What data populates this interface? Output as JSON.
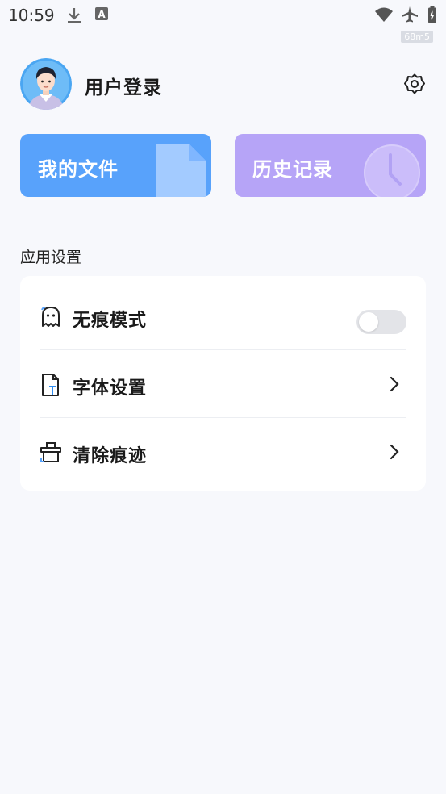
{
  "status_bar": {
    "time": "10:59",
    "fps": "68m5"
  },
  "header": {
    "login_label": "用户登录"
  },
  "cards": {
    "files_label": "我的文件",
    "history_label": "历史记录"
  },
  "section": {
    "title": "应用设置"
  },
  "settings": {
    "incognito_label": "无痕模式",
    "incognito_enabled": false,
    "font_label": "字体设置",
    "clear_label": "清除痕迹"
  }
}
